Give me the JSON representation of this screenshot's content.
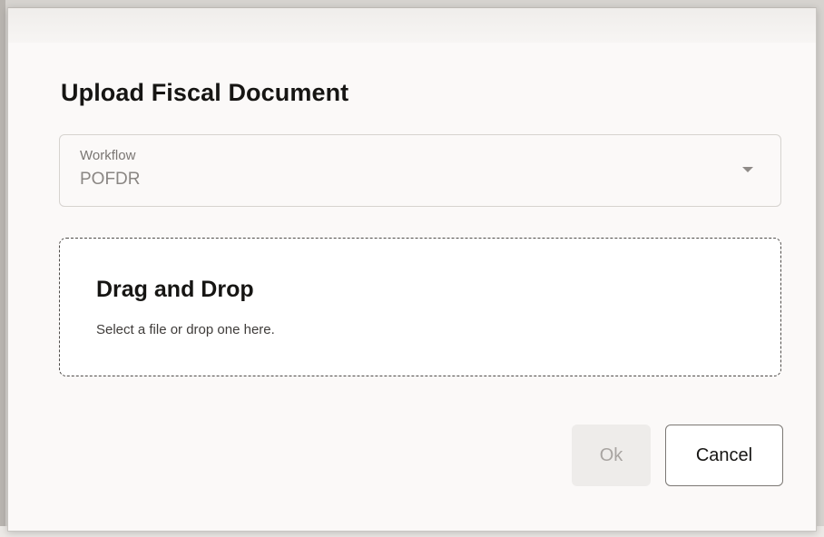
{
  "dialog": {
    "title": "Upload Fiscal Document"
  },
  "workflow_select": {
    "label": "Workflow",
    "value": "POFDR",
    "icon": "chevron-down-icon"
  },
  "drop_zone": {
    "title": "Drag and Drop",
    "subtitle": "Select a file or drop one here."
  },
  "actions": {
    "ok_label": "Ok",
    "cancel_label": "Cancel"
  },
  "colors": {
    "dialog_background": "#fbf9f8",
    "text_primary": "#161513",
    "disabled_button_bg": "#eeecea",
    "disabled_button_text": "#a8a4a1",
    "border": "#d6d3cf"
  }
}
